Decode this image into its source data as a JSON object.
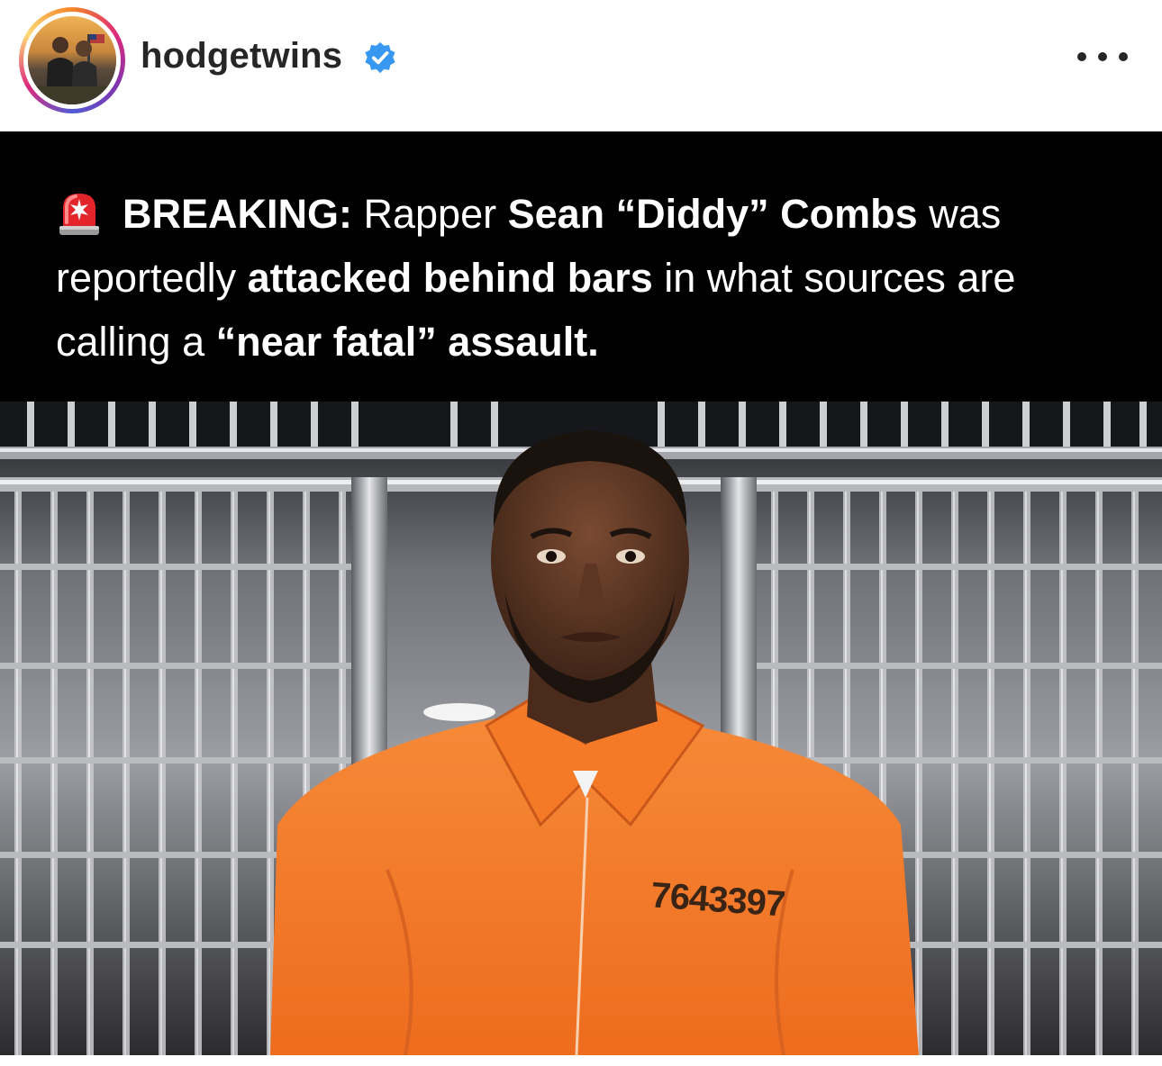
{
  "post": {
    "username": "hodgetwins",
    "verified": true,
    "more_icon": "more-horizontal-icon",
    "image": {
      "headline": {
        "emoji": "siren-icon",
        "parts": [
          {
            "text": "BREAKING:",
            "bold": true
          },
          {
            "text": " Rapper ",
            "bold": false
          },
          {
            "text": "Sean “Diddy” Combs",
            "bold": true
          },
          {
            "text": " was reportedly ",
            "bold": false
          },
          {
            "text": "attacked behind bars",
            "bold": true
          },
          {
            "text": " in what sources are calling a ",
            "bold": false
          },
          {
            "text": "“near fatal” assault.",
            "bold": true
          }
        ]
      },
      "inmate_number": "7643397"
    }
  },
  "colors": {
    "verified_blue": "#3897f0",
    "jumpsuit_orange": "#f47a28",
    "text_dark": "#262626"
  }
}
